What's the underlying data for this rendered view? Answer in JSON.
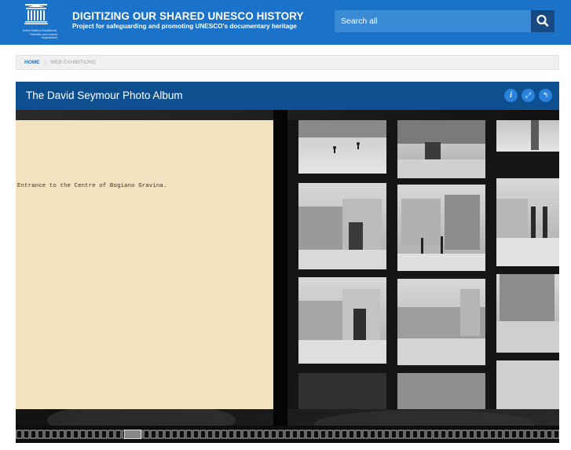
{
  "header": {
    "logo_text": "United Nations Educational, Scientific and Cultural Organization",
    "title": "DIGITIZING OUR SHARED UNESCO HISTORY",
    "subtitle": "Project for safeguarding and promoting UNESCO's documentary heritage",
    "search_placeholder": "Search all",
    "search_icon": "search-icon"
  },
  "breadcrumb": {
    "home": "HOME",
    "separator": "|",
    "current": "WEB EXHIBITIONS"
  },
  "viewer": {
    "title": "The David Seymour Photo Album",
    "buttons": [
      {
        "icon": "info-icon",
        "glyph": "i"
      },
      {
        "icon": "fullscreen-icon",
        "glyph": "⤢"
      },
      {
        "icon": "back-icon",
        "glyph": "↰"
      }
    ],
    "left_page_text": "Entrance to the Centre of Bogiano Gravina."
  },
  "colors": {
    "header_bg": "#1a73c8",
    "viewer_bar_bg": "#0e4f8f",
    "paper": "#f2e2bf"
  }
}
